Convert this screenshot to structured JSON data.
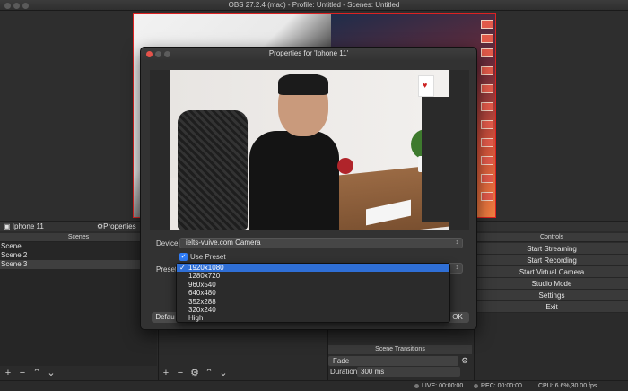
{
  "window": {
    "title": "OBS 27.2.4 (mac) - Profile: Untitled - Scenes: Untitled"
  },
  "sources_bar": {
    "source_name": "Iphone 11",
    "properties_label": "Properties"
  },
  "scenes": {
    "header": "Scenes",
    "items": [
      {
        "label": "Scene"
      },
      {
        "label": "Scene 2"
      },
      {
        "label": "Scene 3",
        "selected": true
      }
    ]
  },
  "controls": {
    "header": "Controls",
    "buttons": [
      {
        "label": "Start Streaming"
      },
      {
        "label": "Start Recording"
      },
      {
        "label": "Start Virtual Camera"
      },
      {
        "label": "Studio Mode"
      },
      {
        "label": "Settings"
      },
      {
        "label": "Exit"
      }
    ]
  },
  "transitions": {
    "header": "Scene Transitions",
    "type": "Fade",
    "duration_label": "Duration",
    "duration_value": "300 ms"
  },
  "status": {
    "live": "LIVE: 00:00:00",
    "rec": "REC: 00:00:00",
    "cpu": "CPU: 6.6%,30.00 fps"
  },
  "dialog": {
    "title": "Properties for 'Iphone 11'",
    "device_label": "Device",
    "device_value": "ielts-vuive.com Camera",
    "use_preset_label": "Use Preset",
    "use_preset_checked": true,
    "preset_label": "Preset",
    "preset_options": [
      "1920x1080",
      "1280x720",
      "960x540",
      "640x480",
      "352x288",
      "320x240",
      "High"
    ],
    "preset_selected": "1920x1080",
    "defaults_label": "Defau",
    "ok_label": "OK"
  },
  "colors": {
    "accent": "#2f6fd6",
    "preview_border": "#dd2222"
  },
  "icons": [
    "add-icon",
    "remove-icon",
    "gear-icon",
    "up-arrow-icon",
    "down-arrow-icon",
    "chevron-updown-icon",
    "checkmark-icon"
  ]
}
